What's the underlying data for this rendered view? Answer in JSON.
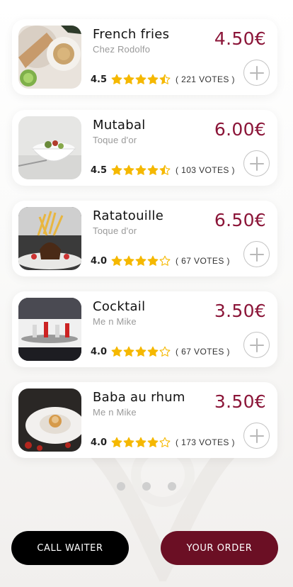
{
  "items": [
    {
      "name": "French fries",
      "venue": "Chez Rodolfo",
      "price": "4.50€",
      "score": "4.5",
      "stars": 4.5,
      "votes": "( 221 VOTES )",
      "image": "fries-plate-with-coffee"
    },
    {
      "name": "Mutabal",
      "venue": "Toque d'or",
      "price": "6.00€",
      "score": "4.5",
      "stars": 4.5,
      "votes": "( 103 VOTES )",
      "image": "white-bowl-dish"
    },
    {
      "name": "Ratatouille",
      "venue": "Toque d'or",
      "price": "6.50€",
      "score": "4.0",
      "stars": 4,
      "votes": "( 67 VOTES )",
      "image": "plated-meat-with-crisps"
    },
    {
      "name": "Cocktail",
      "venue": "Me n Mike",
      "price": "3.50€",
      "score": "4.0",
      "stars": 4,
      "votes": "( 67 VOTES )",
      "image": "waiter-serving-tray"
    },
    {
      "name": "Baba au rhum",
      "venue": "Me n Mike",
      "price": "3.50€",
      "score": "4.0",
      "stars": 4,
      "votes": "( 173 VOTES )",
      "image": "dessert-plate"
    }
  ],
  "pagination": {
    "count": 3
  },
  "actions": {
    "call_waiter": "CALL WAITER",
    "your_order": "YOUR ORDER"
  },
  "colors": {
    "price": "#8b1538",
    "star": "#f5b800",
    "order_button": "#6b0f24",
    "waiter_button": "#000000"
  }
}
